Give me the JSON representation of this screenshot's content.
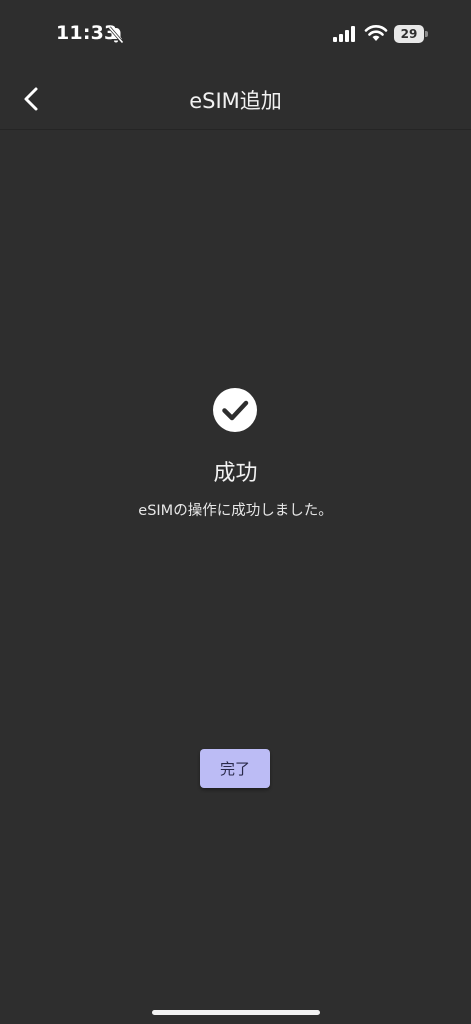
{
  "status_bar": {
    "time": "11:33",
    "battery_level": "29",
    "icons": [
      "bell-slash-icon",
      "cellular-signal-icon",
      "wifi-icon",
      "battery-icon"
    ]
  },
  "header": {
    "title": "eSIM追加",
    "back_icon": "chevron-left-icon"
  },
  "result": {
    "icon": "check-circle-icon",
    "title": "成功",
    "message": "eSIMの操作に成功しました。"
  },
  "actions": {
    "done_label": "完了"
  },
  "colors": {
    "background": "#2e2e2e",
    "button_bg": "#bcbcf5",
    "button_text": "#2a2a4a",
    "text": "#ffffff"
  }
}
